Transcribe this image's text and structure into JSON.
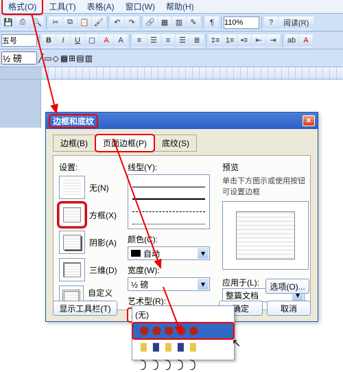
{
  "menu": {
    "format": "格式(O)",
    "tools": "工具(T)",
    "table": "表格(A)",
    "window": "窗口(W)",
    "help": "帮助(H)"
  },
  "toolbar": {
    "zoom": "110%",
    "font_size_label": "五号",
    "read": "阅读(R)",
    "ruler_unit": "½ 磅"
  },
  "dialog": {
    "title": "边框和底纹",
    "tabs": {
      "borders": "边框(B)",
      "page_border": "页面边框(P)",
      "shading": "底纹(S)"
    },
    "settings": {
      "label": "设置:",
      "none": "无(N)",
      "box": "方框(X)",
      "shadow": "阴影(A)",
      "threeD": "三维(D)",
      "custom": "自定义(U)"
    },
    "line": {
      "style_label": "线型(Y):",
      "color_label": "颜色(C):",
      "color_value": "自动",
      "width_label": "宽度(W):",
      "width_value": "½ 磅",
      "art_label": "艺术型(R):",
      "art_value": "(无)"
    },
    "preview": {
      "label": "预览",
      "hint": "单击下方图示或使用按钮可设置边框"
    },
    "applyto": {
      "label": "应用于(L):",
      "value": "整篇文档"
    },
    "buttons": {
      "options": "选项(O)...",
      "show_toolbar": "显示工具栏(T)",
      "ok": "确定",
      "cancel": "取消"
    },
    "art_options": {
      "none": "(无)"
    }
  }
}
